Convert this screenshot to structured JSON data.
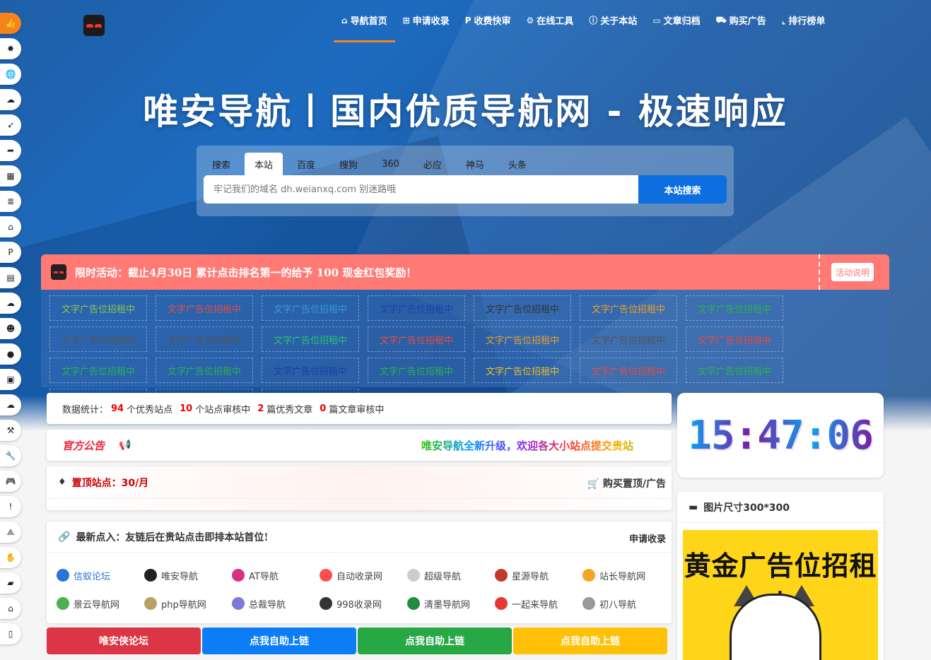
{
  "sidebar": {
    "items": [
      {
        "icon": "thumbs-up-icon",
        "glyph": "👍"
      },
      {
        "icon": "bug-icon",
        "glyph": "✹"
      },
      {
        "icon": "globe-icon",
        "glyph": "🌐"
      },
      {
        "icon": "cloud-icon",
        "glyph": "☁"
      },
      {
        "icon": "rocket-icon",
        "glyph": "➶"
      },
      {
        "icon": "share-icon",
        "glyph": "➦"
      },
      {
        "icon": "film-icon",
        "glyph": "▦"
      },
      {
        "icon": "database-icon",
        "glyph": "≣"
      },
      {
        "icon": "bank-icon",
        "glyph": "⌂"
      },
      {
        "icon": "parking-icon",
        "glyph": "P"
      },
      {
        "icon": "book-icon",
        "glyph": "▤"
      },
      {
        "icon": "cloud-download-icon",
        "glyph": "☁"
      },
      {
        "icon": "users-icon",
        "glyph": "☻"
      },
      {
        "icon": "comment-icon",
        "glyph": "●"
      },
      {
        "icon": "trash-icon",
        "glyph": "▣"
      },
      {
        "icon": "cloud-icon-2",
        "glyph": "☁"
      },
      {
        "icon": "gavel-icon",
        "glyph": "⚒"
      },
      {
        "icon": "wrench-icon",
        "glyph": "🔧"
      },
      {
        "icon": "gamepad-icon",
        "glyph": "🎮"
      },
      {
        "icon": "info-icon",
        "glyph": "!"
      },
      {
        "icon": "sitemap-icon",
        "glyph": "⟁"
      },
      {
        "icon": "handshake-icon",
        "glyph": "✋"
      },
      {
        "icon": "shopping-bag-icon",
        "glyph": "▰"
      },
      {
        "icon": "bank-icon-2",
        "glyph": "⌂"
      },
      {
        "icon": "file-icon",
        "glyph": "▯"
      }
    ]
  },
  "nav": {
    "items": [
      {
        "label": "导航首页",
        "glyph": "⌂",
        "active": true
      },
      {
        "label": "申请收录",
        "glyph": "⊞",
        "active": false
      },
      {
        "label": "收费快审",
        "glyph": "P",
        "active": false
      },
      {
        "label": "在线工具",
        "glyph": "⚙",
        "active": false
      },
      {
        "label": "关于本站",
        "glyph": "ⓘ",
        "active": false
      },
      {
        "label": "文章归档",
        "glyph": "▭",
        "active": false
      },
      {
        "label": "购买广告",
        "glyph": "⛟",
        "active": false
      },
      {
        "label": "排行榜单",
        "glyph": "⌞",
        "active": false
      }
    ]
  },
  "hero": {
    "title": "唯安导航丨国内优质导航网 - 极速响应"
  },
  "search": {
    "tabs": [
      "搜索",
      "本站",
      "百度",
      "搜狗",
      "360",
      "必应",
      "神马",
      "头条"
    ],
    "active_tab": 1,
    "placeholder": "牢记我们的域名 dh.weianxq.com 别迷路哦",
    "button": "本站搜索"
  },
  "promo": {
    "text": "限时活动：截止4月30日 累计点击排名第一的给予 100 现金红包奖励！",
    "button": "活动说明"
  },
  "ads": {
    "label": "文字广告位招租中",
    "colors": [
      "#8bc34a",
      "#e74c3c",
      "#3498db",
      "#1a3fa8",
      "#333333",
      "#f0a020",
      "#2bb24c",
      "#555555",
      "#555555",
      "#2bc26d",
      "#e74c3c",
      "#f0a020",
      "#555555",
      "#e74c3c",
      "#2bb24c",
      "#2bb24c",
      "#1a3fa8",
      "#2bb24c",
      "#f0c020",
      "#e74c3c",
      "#2bb24c",
      "#e74c3c",
      "#8bc34a",
      "#f0a020"
    ]
  },
  "stats": {
    "prefix": "数据统计：",
    "items": [
      {
        "num": "94",
        "label": "个优秀站点"
      },
      {
        "num": "10",
        "label": "个站点审核中"
      },
      {
        "num": "2",
        "label": "篇优秀文章"
      },
      {
        "num": "0",
        "label": "篇文章审核中"
      }
    ]
  },
  "notice": {
    "label": "官方公告",
    "marquee": "唯安导航全新升级，欢迎各大小站点提交贵站"
  },
  "topsite": {
    "label": "置顶站点：30/月",
    "buy": "购买置顶/广告"
  },
  "recent": {
    "title": "最新点入：友链后在贵站点击即排本站首位!",
    "apply": "申请收录",
    "links": [
      {
        "name": "信蚁论坛",
        "color": "#2a73d8"
      },
      {
        "name": "唯安导航",
        "color": "#222222"
      },
      {
        "name": "AT导航",
        "color": "#d63384"
      },
      {
        "name": "自动收录网",
        "color": "#ff4d4f"
      },
      {
        "name": "超级导航",
        "color": "#cccccc"
      },
      {
        "name": "星源导航",
        "color": "#c0392b"
      },
      {
        "name": "站长导航网",
        "color": "#f5a623"
      },
      {
        "name": "景云导航网",
        "color": "#4caf50"
      },
      {
        "name": "php导航网",
        "color": "#b8a060"
      },
      {
        "name": "总裁导航",
        "color": "#7a7ad8"
      },
      {
        "name": "998收录网",
        "color": "#333333"
      },
      {
        "name": "清墨导航网",
        "color": "#1e8e3e"
      },
      {
        "name": "一起来导航",
        "color": "#e53935"
      },
      {
        "name": "初八导航",
        "color": "#999999"
      }
    ]
  },
  "buttons": [
    {
      "label": "唯安侠论坛",
      "color": "#dc3545"
    },
    {
      "label": "点我自助上链",
      "color": "#0d7df5"
    },
    {
      "label": "点我自助上链",
      "color": "#28a745"
    },
    {
      "label": "点我自助上链",
      "color": "#ffc107"
    }
  ],
  "clock": {
    "time": "15:47:06"
  },
  "image_ad": {
    "title": "图片尺寸300*300",
    "ad_text": "黄金广告位招租中"
  }
}
